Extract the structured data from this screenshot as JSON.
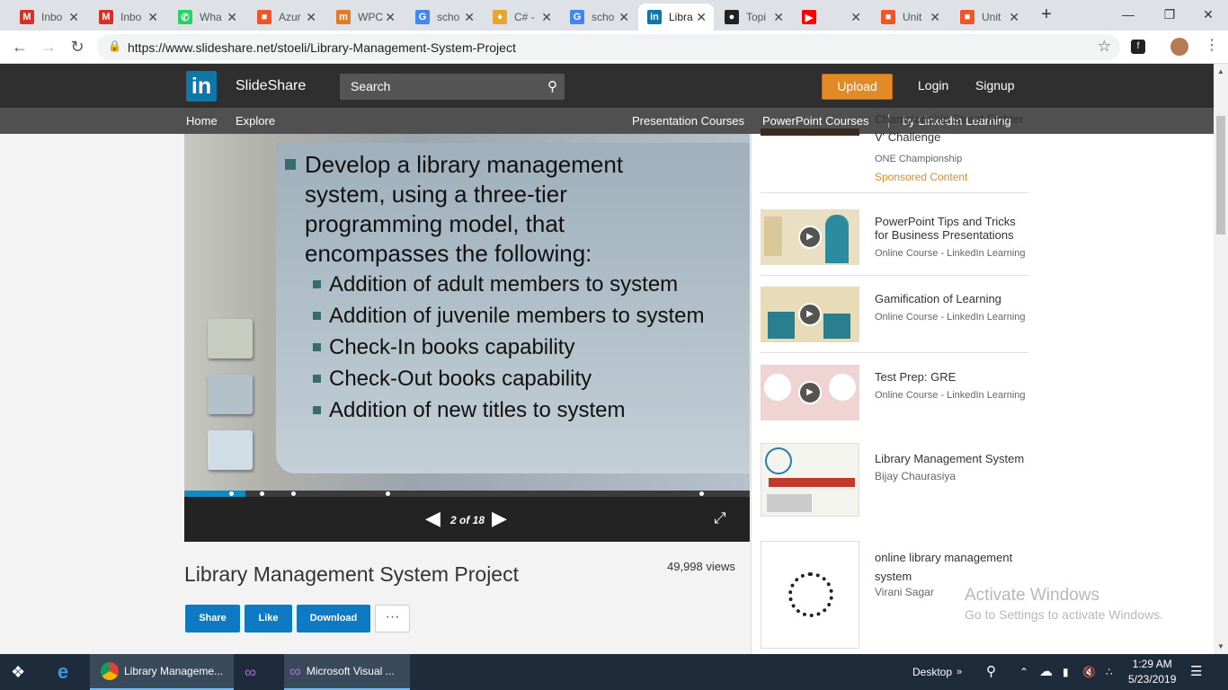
{
  "browser": {
    "tabs": [
      {
        "label": "Inbo",
        "icon": "gmail-icon",
        "color": "#d93025"
      },
      {
        "label": "Inbo",
        "icon": "gmail-icon",
        "color": "#d93025"
      },
      {
        "label": "Wha",
        "icon": "whatsapp-icon",
        "color": "#25d366"
      },
      {
        "label": "Azur",
        "icon": "windows-icon",
        "color": "#f35325"
      },
      {
        "label": "WPC",
        "icon": "tm-icon",
        "color": "#e07b28"
      },
      {
        "label": "scho",
        "icon": "google-icon",
        "color": "#4285f4"
      },
      {
        "label": "C# -",
        "icon": "csharp-icon",
        "color": "#e8a72c"
      },
      {
        "label": "scho",
        "icon": "google-icon",
        "color": "#4285f4"
      },
      {
        "label": "Libra",
        "icon": "linkedin-icon",
        "color": "#0e76a8"
      },
      {
        "label": "Topi",
        "icon": "github-icon",
        "color": "#222222"
      },
      {
        "label": "",
        "icon": "youtube-icon",
        "color": "#ff0000"
      },
      {
        "label": "Unit",
        "icon": "windows-icon",
        "color": "#f35325"
      },
      {
        "label": "Unit",
        "icon": "windows-icon",
        "color": "#f35325"
      }
    ],
    "active_tab_index": 8,
    "url": "https://www.slideshare.net/stoeli/Library-Management-System-Project"
  },
  "site": {
    "logo_text": "in",
    "brand": "SlideShare",
    "search_placeholder": "Search",
    "upload": "Upload",
    "login": "Login",
    "signup": "Signup",
    "nav_left": [
      "Home",
      "Explore"
    ],
    "nav_right": [
      "Presentation Courses",
      "PowerPoint Courses",
      "by LinkedIn Learning"
    ],
    "accent_color": "#0e76a8"
  },
  "slide": {
    "main_bullet": [
      "Develop a library management",
      "system, using a three-tier",
      "programming model, that",
      "encompasses the following:"
    ],
    "sub_bullets": [
      "Addition of adult members to system",
      "Addition of juvenile members to system",
      "Check-In books capability",
      "Check-Out books capability",
      "Addition of new titles to system"
    ],
    "counter": "2 of 18"
  },
  "presentation": {
    "title": "Library Management System Project",
    "views": "49,998 views",
    "buttons": {
      "share": "Share",
      "like": "Like",
      "download": "Download",
      "more": "···"
    }
  },
  "related": [
    {
      "title": "Championship Street Fighter V' Challenge",
      "source": "ONE Championship",
      "sponsored": "Sponsored Content"
    },
    {
      "title": "PowerPoint Tips and Tricks for Business Presentations",
      "source": "Online Course - LinkedIn Learning"
    },
    {
      "title": "Gamification of Learning",
      "source": "Online Course - LinkedIn Learning"
    },
    {
      "title": "Test Prep: GRE",
      "source": "Online Course - LinkedIn Learning"
    },
    {
      "title": "Library Management System",
      "source": "Bijay Chaurasiya"
    },
    {
      "title": "online library management system",
      "source": "Virani Sagar"
    }
  ],
  "watermark": {
    "line1": "Activate Windows",
    "line2": "Go to Settings to activate Windows."
  },
  "taskbar": {
    "chrome_label": "Library Manageme...",
    "vs_label": "Microsoft Visual ...",
    "desktop": "Desktop",
    "time": "1:29 AM",
    "date": "5/23/2019"
  }
}
